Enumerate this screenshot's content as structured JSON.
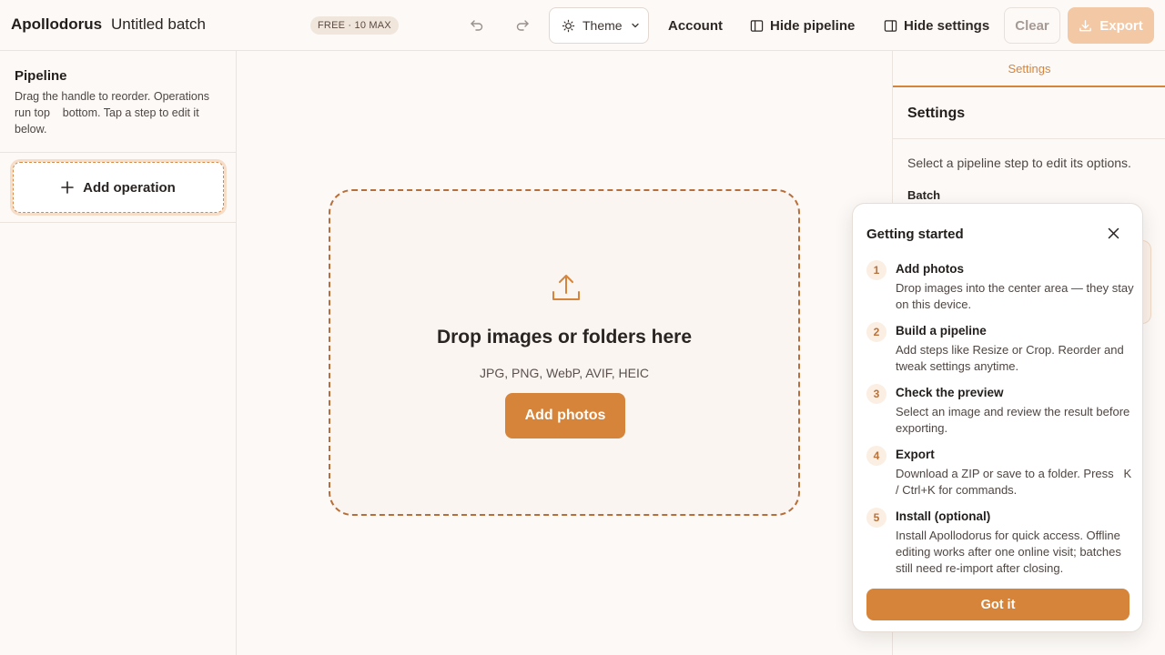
{
  "header": {
    "brand": "Apollodorus",
    "batch_title": "Untitled batch",
    "plan_badge": "FREE · 10 MAX",
    "theme_label": "Theme",
    "account_label": "Account",
    "hide_pipeline_label": "Hide pipeline",
    "hide_settings_label": "Hide settings",
    "clear_label": "Clear",
    "export_label": "Export"
  },
  "pipeline": {
    "title": "Pipeline",
    "description": "Drag the handle to reorder. Operations run top    bottom. Tap a step to edit it below.",
    "add_operation_label": "Add operation"
  },
  "dropzone": {
    "title": "Drop images or folders here",
    "formats": "JPG, PNG, WebP, AVIF, HEIC",
    "add_photos_label": "Add photos"
  },
  "settings": {
    "tab_label": "Settings",
    "title": "Settings",
    "hint": "Select a pipeline step to edit its options.",
    "batch_label": "Batch"
  },
  "getting_started": {
    "title": "Getting started",
    "steps": [
      {
        "num": "1",
        "title": "Add photos",
        "desc": "Drop images into the center area — they stay on this device."
      },
      {
        "num": "2",
        "title": "Build a pipeline",
        "desc": "Add steps like Resize or Crop. Reorder and tweak settings anytime."
      },
      {
        "num": "3",
        "title": "Check the preview",
        "desc": "Select an image and review the result before exporting."
      },
      {
        "num": "4",
        "title": "Export",
        "desc": "Download a ZIP or save to a folder. Press   K / Ctrl+K for commands."
      },
      {
        "num": "5",
        "title": "Install (optional)",
        "desc": "Install Apollodorus for quick access. Offline editing works after one online visit; batches still need re-import after closing."
      }
    ],
    "got_it_label": "Got it"
  },
  "colors": {
    "accent": "#d6843a",
    "accent_disabled": "#f2c8a5",
    "background": "#fcf9f7"
  },
  "icons": [
    "undo-icon",
    "redo-icon",
    "sun-icon",
    "chevron-down-icon",
    "sidebar-left-icon",
    "sidebar-right-icon",
    "download-icon",
    "plus-icon",
    "upload-icon",
    "close-icon"
  ]
}
